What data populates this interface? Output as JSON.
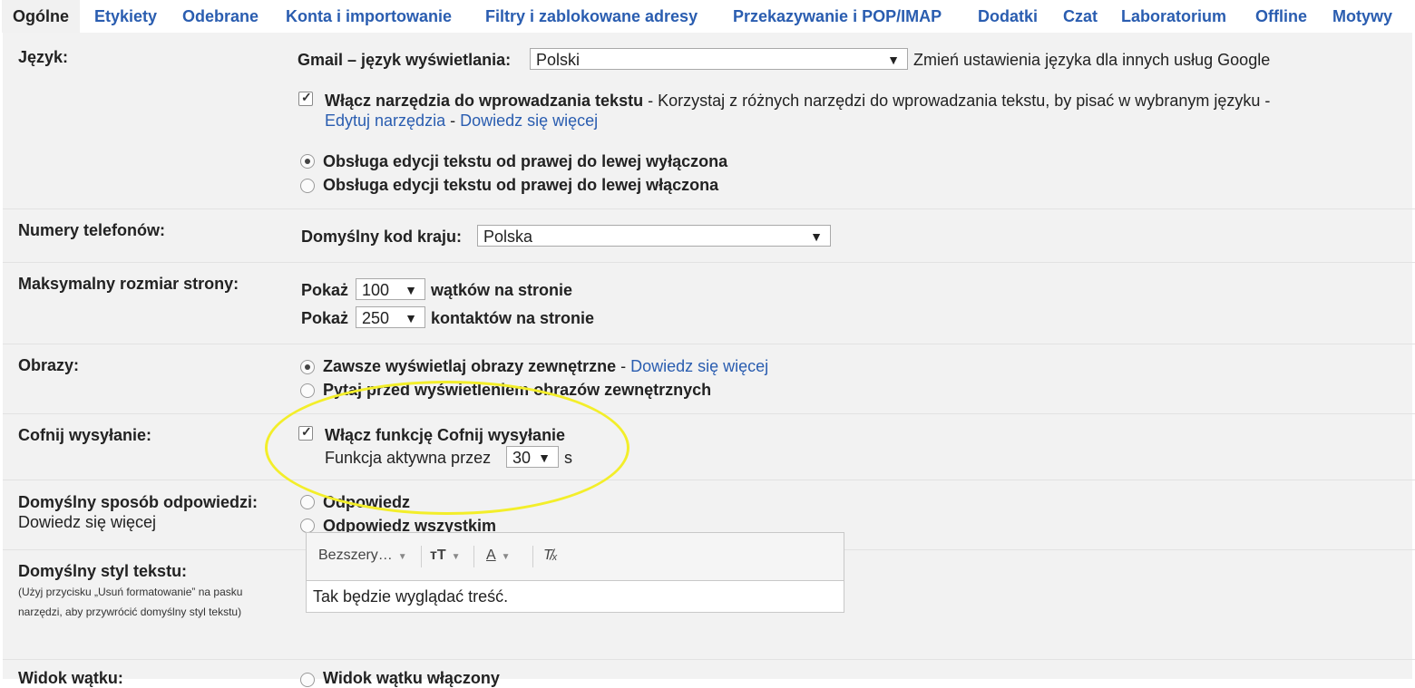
{
  "tabs": [
    "Ogólne",
    "Etykiety",
    "Odebrane",
    "Konta i importowanie",
    "Filtry i zablokowane adresy",
    "Przekazywanie i POP/IMAP",
    "Dodatki",
    "Czat",
    "Laboratorium",
    "Offline",
    "Motywy"
  ],
  "language": {
    "label": "Język:",
    "display_label": "Gmail – język wyświetlania:",
    "display_value": "Polski",
    "change_link": "Zmień ustawienia języka dla innych usług Google",
    "tools_label": "Włącz narzędzia do wprowadzania tekstu",
    "tools_desc": " - Korzystaj z różnych narzędzi do wprowadzania tekstu, by pisać w wybranym języku -",
    "edit_tools_link": "Edytuj narzędzia",
    "dash": " - ",
    "learn_more_link": "Dowiedz się więcej",
    "rtl_off": "Obsługa edycji tekstu od prawej do lewej wyłączona",
    "rtl_on": "Obsługa edycji tekstu od prawej do lewej włączona",
    "tools_checked": true,
    "rtl_selected": "off"
  },
  "phone": {
    "label": "Numery telefonów:",
    "country_label": "Domyślny kod kraju:",
    "country_value": "Polska"
  },
  "page_size": {
    "label": "Maksymalny rozmiar strony:",
    "show": "Pokaż",
    "threads_value": "100",
    "threads_suffix": "wątków na stronie",
    "contacts_value": "250",
    "contacts_suffix": "kontaktów na stronie"
  },
  "images": {
    "label": "Obrazy:",
    "always": "Zawsze wyświetlaj obrazy zewnętrzne",
    "dash": " - ",
    "learn_more_link": "Dowiedz się więcej",
    "ask": "Pytaj przed wyświetleniem obrazów zewnętrznych",
    "selected": "always"
  },
  "undo_send": {
    "label": "Cofnij wysyłanie:",
    "enable": "Włącz funkcję Cofnij wysyłanie",
    "checked": true,
    "period_label": "Funkcja aktywna przez",
    "period_value": "30",
    "unit": "s"
  },
  "reply": {
    "label": "Domyślny sposób odpowiedzi:",
    "learn_more_link": "Dowiedz się więcej",
    "reply": "Odpowiedz",
    "reply_all": "Odpowiedz wszystkim"
  },
  "text_style": {
    "label": "Domyślny styl tekstu:",
    "hint_line1": "(Użyj przycisku „Usuń formatowanie” na pasku",
    "hint_line2": "narzędzi, aby przywrócić domyślny styl tekstu)",
    "font_button": "Bezszery…",
    "size_icon": "ᴛT",
    "color_icon": "A",
    "clear_icon": "T̸ₓ",
    "preview": "Tak będzie wyglądać treść."
  },
  "thread_view": {
    "label": "Widok wątku:",
    "option": "Widok wątku włączony"
  },
  "colors": {
    "link": "#2a5db0",
    "panel_bg": "#f2f2f2",
    "highlight": "#f3ee2a"
  }
}
